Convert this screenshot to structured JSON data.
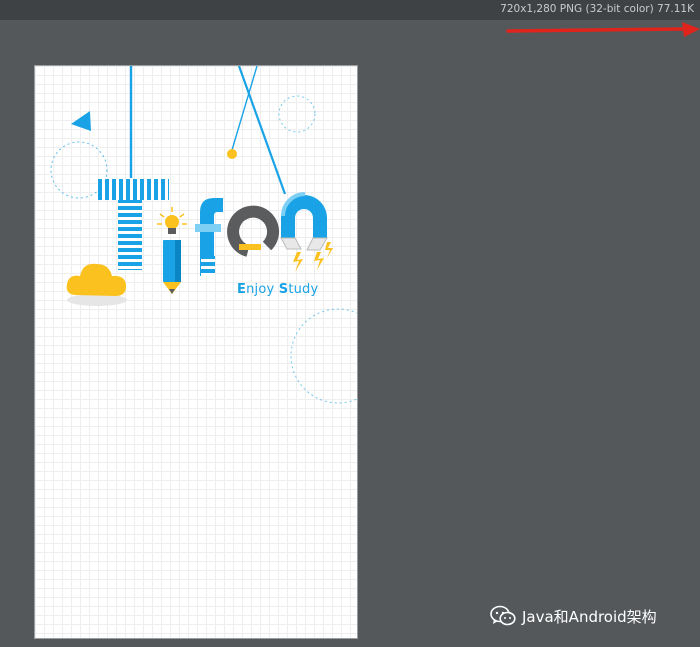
{
  "viewer": {
    "file_info": "720x1,280 PNG (32-bit color) 77.11K"
  },
  "preview": {
    "tagline_e": "E",
    "tagline_rest_1": "njoy ",
    "tagline_s": "S",
    "tagline_rest_2": "tudy"
  },
  "watermark": {
    "icon": "wechat-icon",
    "text": "Java和Android架构"
  },
  "colors": {
    "accent_blue": "#19a3e6",
    "light_blue": "#7dd0f4",
    "yellow": "#fbc21f",
    "gray": "#5a5c5e",
    "arrow_red": "#e0241b",
    "canvas_bg": "#55585b"
  }
}
